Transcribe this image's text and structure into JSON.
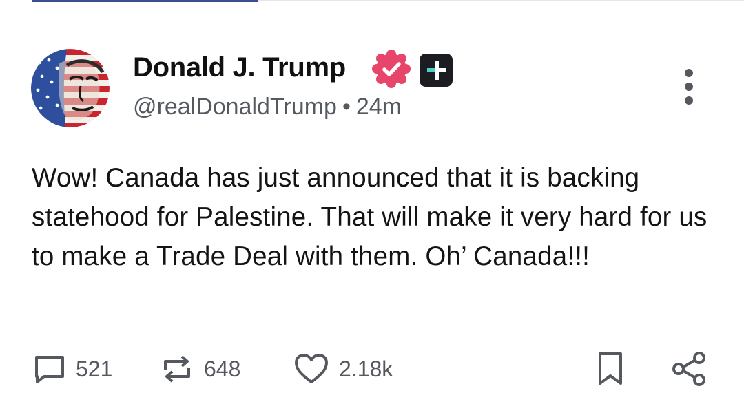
{
  "post": {
    "author": {
      "display_name": "Donald J. Trump",
      "handle": "@realDonaldTrump",
      "verified": true,
      "verified_color": "#e8456b",
      "avatar_icon": "flag-portrait-avatar",
      "plus_badge_icon": "plus-badge-icon"
    },
    "separator": "•",
    "time_ago": "24m",
    "body": "Wow! Canada has just announced that it is backing statehood for Palestine. That will make it very hard for us to make a Trade Deal with them. Oh’ Canada!!!",
    "actions": {
      "replies": "521",
      "reposts": "648",
      "likes": "2.18k"
    },
    "icons": {
      "more": "more-vertical-icon",
      "reply": "comment-icon",
      "repost": "repost-icon",
      "like": "heart-icon",
      "bookmark": "bookmark-icon",
      "share": "share-icon"
    }
  }
}
